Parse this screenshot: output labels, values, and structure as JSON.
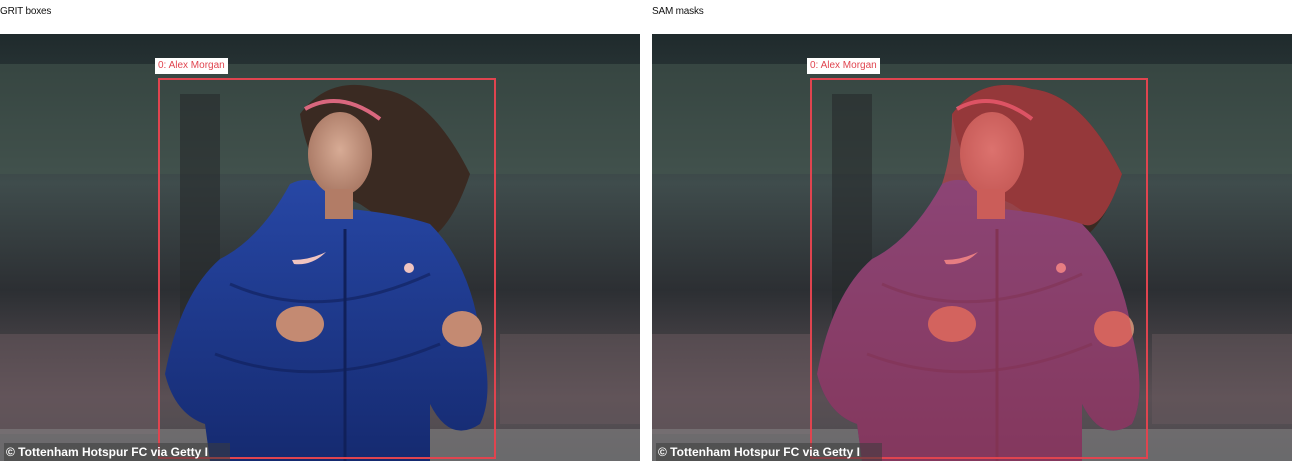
{
  "panels": [
    {
      "title": "GRIT boxes",
      "box_label": "0: Alex Morgan",
      "credit": "© Tottenham Hotspur FC via Getty I",
      "mask": false
    },
    {
      "title": "SAM masks",
      "box_label": "0: Alex Morgan",
      "credit": "© Tottenham Hotspur FC via Getty I",
      "mask": true
    }
  ],
  "colors": {
    "box": "#e0444f",
    "mask": "#e0444f",
    "jacket": "#1e3a8c"
  }
}
